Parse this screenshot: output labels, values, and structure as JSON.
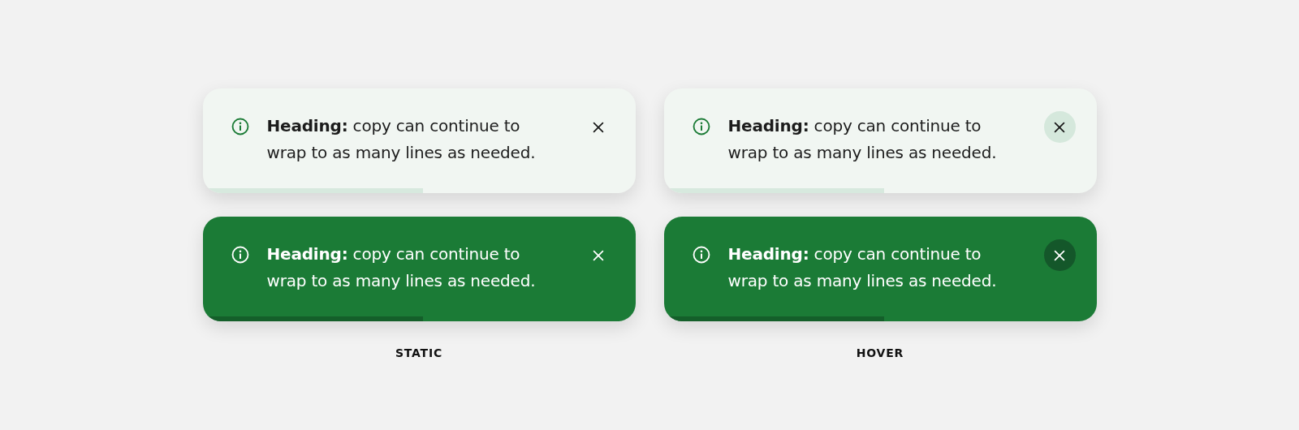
{
  "columns": [
    {
      "label": "STATIC",
      "toasts": [
        {
          "kind": "light",
          "text": "**Heading:** copy can continue to wrap to as many lines as needed.",
          "level": 0.51,
          "close_hovered": false
        },
        {
          "kind": "dark",
          "text": "**Heading:** copy can continue to wrap to as many lines as needed.",
          "level": 0.51,
          "close_hovered": false
        }
      ]
    },
    {
      "label": "HOVER",
      "toasts": [
        {
          "kind": "light",
          "text": "**Heading:** copy can continue to wrap to as many lines as needed.",
          "level": 0.51,
          "close_hovered": true
        },
        {
          "kind": "dark",
          "text": "**Heading:** copy can continue to wrap to as many lines as needed.",
          "level": 0.51,
          "close_hovered": true
        }
      ]
    }
  ]
}
